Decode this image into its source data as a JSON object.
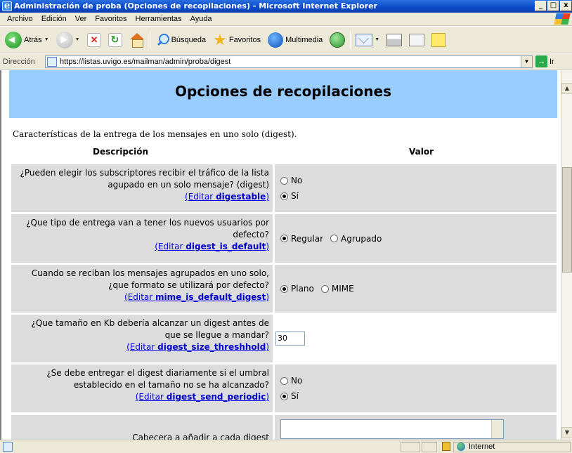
{
  "window": {
    "title": "Administración de proba (Opciones de recopilaciones) - Microsoft Internet Explorer",
    "controls": [
      "_",
      "□",
      "x"
    ]
  },
  "menu": [
    "Archivo",
    "Edición",
    "Ver",
    "Favoritos",
    "Herramientas",
    "Ayuda"
  ],
  "toolbar": {
    "back_label": "Atrás",
    "search_label": "Búsqueda",
    "favorites_label": "Favoritos",
    "media_label": "Multimedia"
  },
  "address": {
    "label": "Dirección",
    "url": "https://listas.uvigo.es/mailman/admin/proba/digest",
    "go_label": "Ir"
  },
  "page": {
    "title": "Opciones de recopilaciones",
    "description": "Características de la entrega de los mensajes en uno solo (digest).",
    "col_description": "Descripción",
    "col_value": "Valor",
    "rows": [
      {
        "question": "¿Pueden elegir los subscriptores recibir el tráfico de la lista agupado en un solo mensaje? (digest)",
        "edit_prefix": "(Editar ",
        "edit_var": "digestable",
        "edit_suffix": ")",
        "options": [
          {
            "label": "No",
            "selected": false
          },
          {
            "label": "Sí",
            "selected": true
          }
        ]
      },
      {
        "question": "¿Que tipo de entrega van a tener los nuevos usuarios por defecto?",
        "edit_prefix": "(Editar ",
        "edit_var": "digest_is_default",
        "edit_suffix": ")",
        "options": [
          {
            "label": "Regular",
            "selected": true
          },
          {
            "label": "Agrupado",
            "selected": false
          }
        ]
      },
      {
        "question": "Cuando se reciban los mensajes agrupados en uno solo, ¿que formato se utilizará por defecto?",
        "edit_prefix": "(Editar ",
        "edit_var": "mime_is_default_digest",
        "edit_suffix": ")",
        "options": [
          {
            "label": "Plano",
            "selected": true
          },
          {
            "label": "MIME",
            "selected": false
          }
        ]
      },
      {
        "question": "¿Que tamaño en Kb debería alcanzar un digest antes de que se llegue a mandar?",
        "edit_prefix": "(Editar ",
        "edit_var": "digest_size_threshhold",
        "edit_suffix": ")",
        "input_value": "30"
      },
      {
        "question": "¿Se debe entregar el digest diariamente si el umbral establecido en el tamaño no se ha alcanzado?",
        "edit_prefix": "(Editar ",
        "edit_var": "digest_send_periodic",
        "edit_suffix": ")",
        "options": [
          {
            "label": "No",
            "selected": false
          },
          {
            "label": "Sí",
            "selected": true
          }
        ]
      },
      {
        "question": "Cabecera a añadir a cada digest"
      }
    ]
  },
  "status": {
    "zone": "Internet"
  },
  "icons": [
    "ie-page-icon",
    "windows-logo-icon",
    "back-icon",
    "forward-icon",
    "stop-icon",
    "refresh-icon",
    "home-icon",
    "search-icon",
    "favorites-star-icon",
    "media-icon",
    "history-icon",
    "mail-icon",
    "print-icon",
    "edit-icon",
    "note-icon",
    "go-arrow-icon",
    "lock-icon",
    "globe-icon"
  ]
}
